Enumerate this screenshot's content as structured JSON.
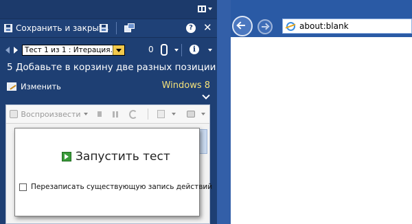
{
  "runner": {
    "toolbar": {
      "save_close_label": "Сохранить и закрыть",
      "help_glyph": "?",
      "close_glyph": "✕"
    },
    "nav": {
      "iteration_value": "Тест 1 из 1 : Итерация...",
      "attachment_count": "0",
      "info_glyph": "i"
    },
    "step_title": "5 Добавьте в корзину две разных позиции",
    "edit_label": "Изменить",
    "configuration": "Windows 8",
    "action_toolbar": {
      "play_label": "Воспроизвести"
    },
    "start_dialog": {
      "start_label": "Запустить тест",
      "overwrite_label": "Перезаписать существующую запись действий"
    }
  },
  "browser": {
    "address": "about:blank"
  },
  "colors": {
    "panel_bg": "#1e3f73",
    "os_label": "#f5e27a",
    "browser_chrome": "#2a5aa5"
  }
}
